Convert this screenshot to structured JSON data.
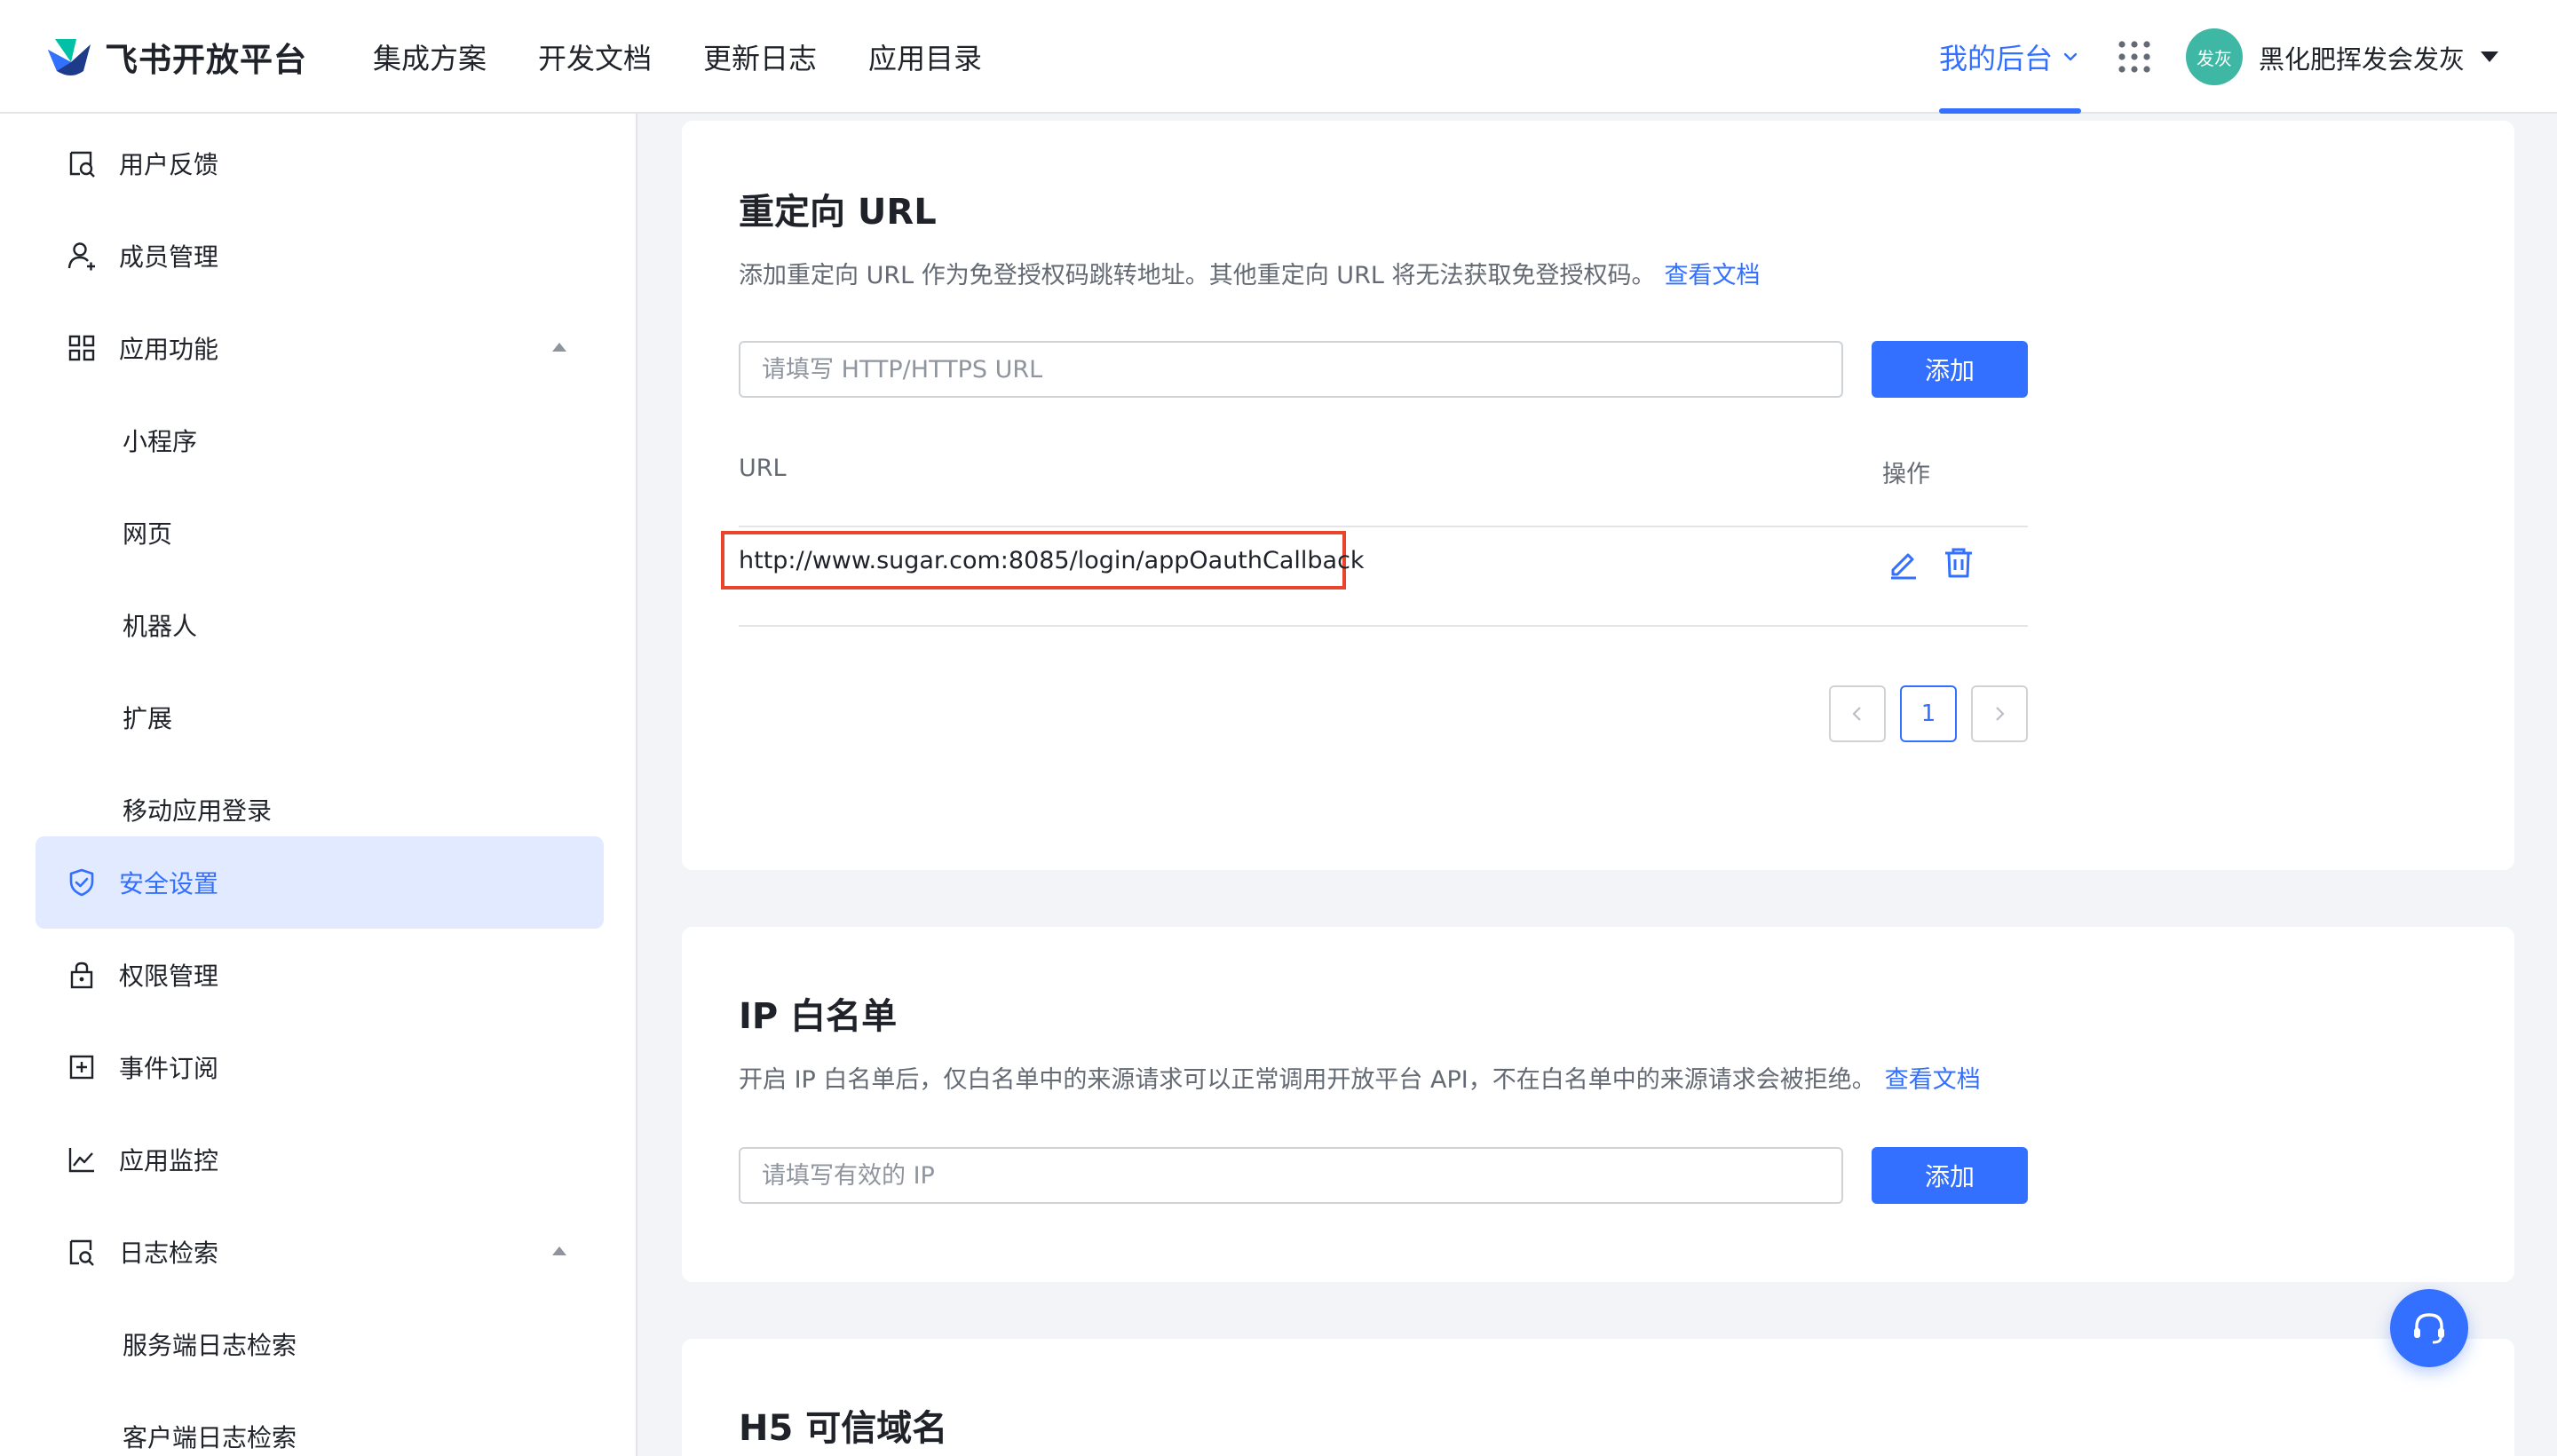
{
  "header": {
    "brand": "飞书开放平台",
    "nav": [
      "集成方案",
      "开发文档",
      "更新日志",
      "应用目录"
    ],
    "console_label": "我的后台",
    "avatar_text": "发灰",
    "username": "黑化肥挥发会发灰"
  },
  "sidebar": {
    "items": [
      {
        "label": "用户反馈",
        "icon": "feedback-icon"
      },
      {
        "label": "成员管理",
        "icon": "user-icon"
      },
      {
        "label": "应用功能",
        "icon": "grid-icon"
      },
      {
        "label": "小程序"
      },
      {
        "label": "网页"
      },
      {
        "label": "机器人"
      },
      {
        "label": "扩展"
      },
      {
        "label": "移动应用登录"
      },
      {
        "label": "安全设置",
        "icon": "shield-icon"
      },
      {
        "label": "权限管理",
        "icon": "lock-icon"
      },
      {
        "label": "事件订阅",
        "icon": "event-icon"
      },
      {
        "label": "应用监控",
        "icon": "chart-line-icon"
      },
      {
        "label": "日志检索",
        "icon": "log-search-icon"
      },
      {
        "label": "服务端日志检索"
      },
      {
        "label": "客户端日志检索"
      }
    ]
  },
  "redirect": {
    "title": "重定向 URL",
    "desc": "添加重定向 URL 作为免登授权码跳转地址。其他重定向 URL 将无法获取免登授权码。",
    "doc_link": "查看文档",
    "placeholder": "请填写 HTTP/HTTPS URL",
    "add_label": "添加",
    "col_url": "URL",
    "col_ops": "操作",
    "rows": [
      {
        "url": "http://www.sugar.com:8085/login/appOauthCallback"
      }
    ],
    "page": "1"
  },
  "ip_whitelist": {
    "title": "IP 白名单",
    "desc": "开启 IP 白名单后，仅白名单中的来源请求可以正常调用开放平台 API，不在白名单中的来源请求会被拒绝。",
    "doc_link": "查看文档",
    "placeholder": "请填写有效的 IP",
    "add_label": "添加"
  },
  "h5_domain": {
    "title": "H5 可信域名"
  },
  "colors": {
    "accent": "#3370ff",
    "highlight": "#e8452c",
    "active_bg": "#e1eaff"
  }
}
